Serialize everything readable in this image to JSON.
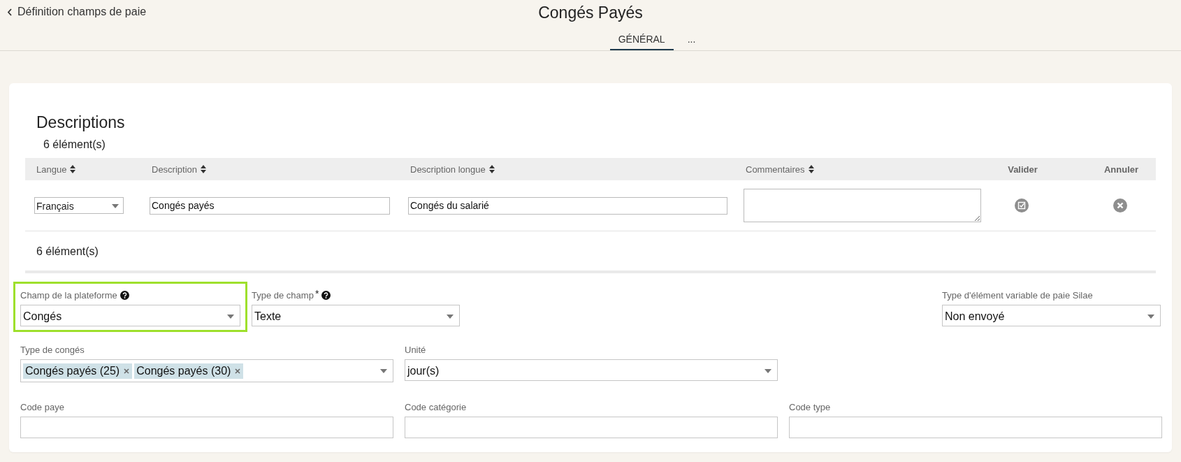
{
  "header": {
    "back_link": "Définition champs de paie",
    "title": "Congés Payés"
  },
  "tabs": [
    {
      "label": "GÉNÉRAL",
      "selected": true
    },
    {
      "label": "...",
      "selected": false
    }
  ],
  "descriptions": {
    "title": "Descriptions",
    "count_top": "6 élément(s)",
    "count_bottom": "6 élément(s)",
    "columns": [
      {
        "label": "Langue",
        "sortable": true
      },
      {
        "label": "Description",
        "sortable": true
      },
      {
        "label": "Description longue",
        "sortable": true
      },
      {
        "label": "Commentaires",
        "sortable": true
      },
      {
        "label": "Valider",
        "sortable": false
      },
      {
        "label": "Annuler",
        "sortable": false
      }
    ],
    "edit_row": {
      "langue": "Français",
      "description": "Congés payés",
      "description_longue": "Congés du salarié"
    }
  },
  "field_rows": [
    {
      "fields": [
        {
          "kind": "select",
          "label": "Champ de la plateforme",
          "help": true,
          "highlighted": true,
          "value": "Congés"
        },
        {
          "kind": "select",
          "label": "Type de champ",
          "required_mark": "*",
          "help": true,
          "highlighted": false,
          "value": "Texte"
        },
        {
          "kind": "spacer"
        },
        {
          "kind": "select",
          "label": "Type d'élément variable de paie Silae",
          "help": false,
          "highlighted": false,
          "value": "Non envoyé"
        }
      ]
    },
    {
      "fields": [
        {
          "kind": "multiselect",
          "label": "Type de congés",
          "help": false,
          "highlighted": false,
          "tags": [
            "Congés payés (25)",
            "Congés payés (30)"
          ]
        },
        {
          "kind": "select",
          "label": "Unité",
          "help": false,
          "highlighted": false,
          "value": "jour(s)"
        }
      ]
    },
    {
      "fields": [
        {
          "kind": "text",
          "label": "Code paye",
          "help": false,
          "highlighted": false
        },
        {
          "kind": "text",
          "label": "Code catégorie",
          "help": false,
          "highlighted": false
        },
        {
          "kind": "text",
          "label": "Code type",
          "help": false,
          "highlighted": false
        }
      ]
    }
  ]
}
